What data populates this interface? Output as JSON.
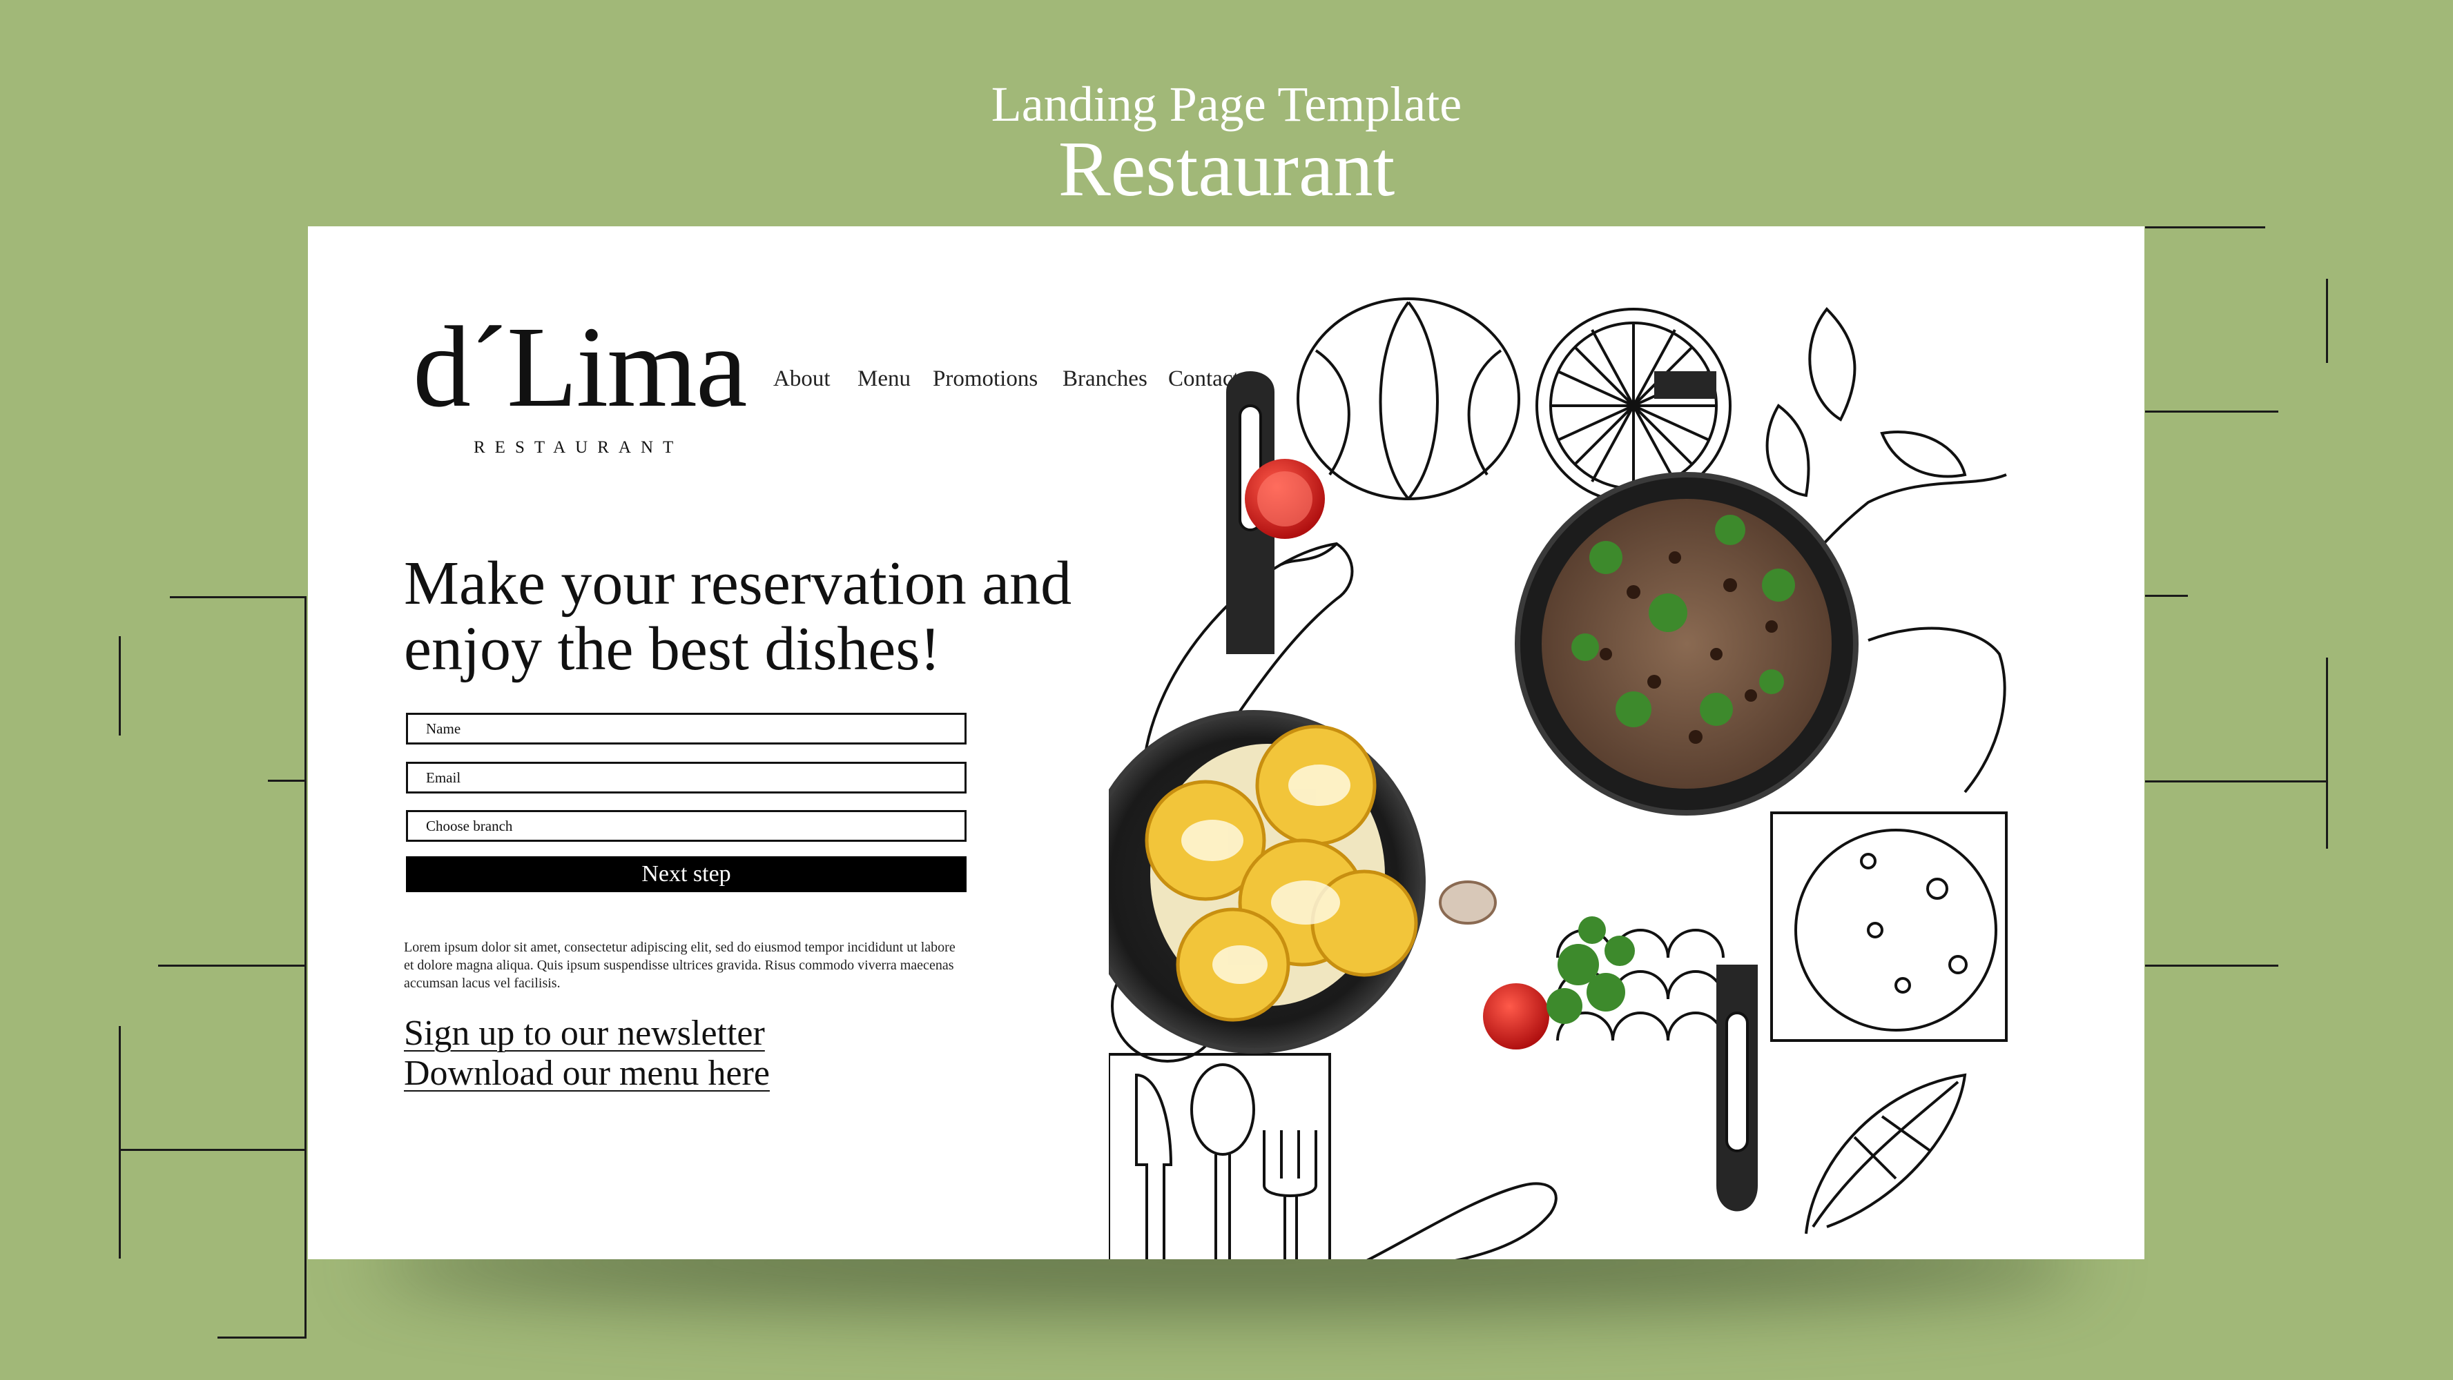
{
  "showcase": {
    "subtitle": "Landing Page Template",
    "title": "Restaurant"
  },
  "brand": {
    "name": "d´Lima",
    "tagline": "RESTAURANT"
  },
  "nav": {
    "items": [
      "About",
      "Menu",
      "Promotions",
      "Branches",
      "Contact"
    ]
  },
  "hero": {
    "headline_line1": "Make your reservation and",
    "headline_line2": "enjoy the best dishes!"
  },
  "form": {
    "name_placeholder": "Name",
    "email_placeholder": "Email",
    "branch_placeholder": "Choose branch",
    "submit_label": "Next step"
  },
  "body_text": "Lorem ipsum dolor sit amet, consectetur adipiscing elit, sed do eiusmod tempor incididunt ut labore et dolore magna aliqua.  Quis ipsum suspendisse ultrices gravida. Risus commodo viverra maecenas accumsan lacus vel facilisis.",
  "links": {
    "newsletter": "Sign up to our newsletter",
    "menu_download": "Download our menu here"
  },
  "colors": {
    "background": "#a1b878",
    "page": "#ffffff",
    "button": "#000000",
    "text": "#111111"
  },
  "illustration": {
    "pan_left": "skillet with corn on the cob in cheese sauce",
    "pan_right": "skillet with rice, beans and cilantro",
    "outline_icons": [
      "pumpkin-icon",
      "lemon-slice-icon",
      "herb-icon",
      "pepper-icon",
      "tomato-icon",
      "knife-icon",
      "spoon-icon",
      "fork-icon",
      "pizza-icon",
      "leaf-icon"
    ]
  }
}
